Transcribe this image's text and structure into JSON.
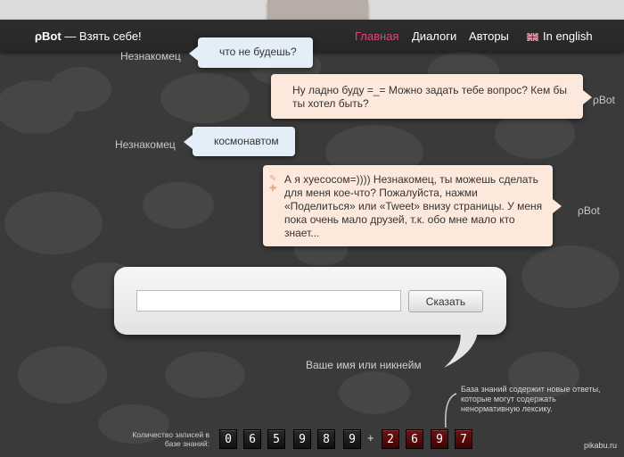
{
  "header": {
    "logo_mark": "ρBot",
    "tagline": " — Взять себе!",
    "nav": [
      {
        "label": "Главная",
        "active": true
      },
      {
        "label": "Диалоги"
      },
      {
        "label": "Авторы"
      },
      {
        "label": "In english"
      }
    ]
  },
  "chat": {
    "messages": [
      {
        "speaker": "Незнакомец",
        "text": "что не будешь?"
      },
      {
        "speaker": "ρBot",
        "text": "Ну ладно буду =_= Можно задать тебе вопрос? Кем бы ты хотел быть?"
      },
      {
        "speaker": "Незнакомец",
        "text": "космонавтом"
      },
      {
        "speaker": "ρBot",
        "text": "А я хуесосом=)))) Незнакомец, ты можешь сделать для меня кое-что? Пожалуйста, нажми «Поделиться» или «Tweet» внизу страницы. У меня пока очень мало друзей, т.к. обо мне мало кто знает..."
      }
    ]
  },
  "input": {
    "value": "",
    "placeholder": "",
    "button": "Сказать",
    "nickname_label": "Ваше имя или никнейм"
  },
  "knowledge": {
    "note": "База знаний содержит новые ответы, которые могут содержать ненормативную лексику.",
    "count_label": "Количество записей в базе знаний:",
    "main_digits": [
      "0",
      "6",
      "5",
      "9",
      "8",
      "9"
    ],
    "plus": "+",
    "new_digits": [
      "2",
      "6",
      "9",
      "7"
    ]
  },
  "watermark": "pikabu.ru",
  "colors": {
    "nav_active": "#e0447d",
    "user_bubble": "#e3eef9",
    "bot_bubble": "#fde9dc",
    "counter_new": "#6e1212"
  }
}
